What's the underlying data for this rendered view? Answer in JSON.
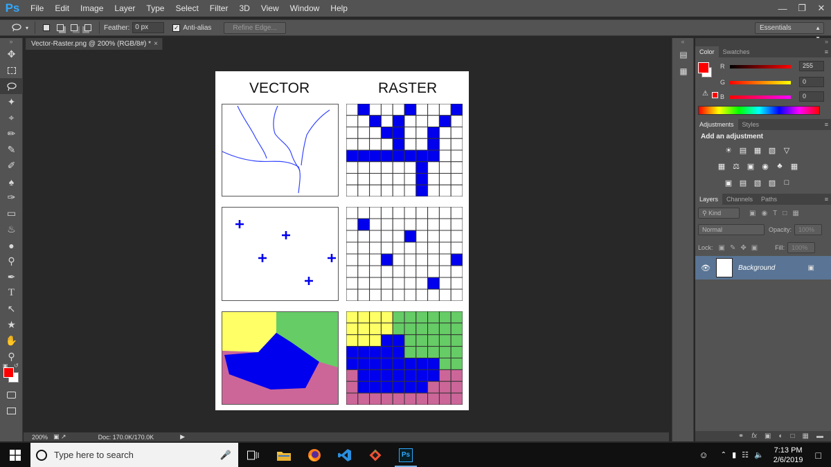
{
  "app": {
    "logo": "Ps",
    "menu": [
      "File",
      "Edit",
      "Image",
      "Layer",
      "Type",
      "Select",
      "Filter",
      "3D",
      "View",
      "Window",
      "Help"
    ]
  },
  "options_bar": {
    "feather_label": "Feather:",
    "feather_value": "0 px",
    "antialias_label": "Anti-alias",
    "antialias_checked": true,
    "refine_edge_label": "Refine Edge...",
    "workspace": "Essentials"
  },
  "document": {
    "tab_title": "Vector-Raster.png @ 200% (RGB/8#) *",
    "heading_vector": "VECTOR",
    "heading_raster": "RASTER"
  },
  "status_bar": {
    "zoom": "200%",
    "doc_size": "Doc: 170.0K/170.0K"
  },
  "color_panel": {
    "tabs": [
      "Color",
      "Swatches"
    ],
    "foreground": "#ff0000",
    "background": "#ffffff",
    "channels": [
      {
        "label": "R",
        "value": "255"
      },
      {
        "label": "G",
        "value": "0"
      },
      {
        "label": "B",
        "value": "0"
      }
    ]
  },
  "adjustments_panel": {
    "tabs": [
      "Adjustments",
      "Styles"
    ],
    "title": "Add an adjustment"
  },
  "layers_panel": {
    "tabs": [
      "Layers",
      "Channels",
      "Paths"
    ],
    "kind_filter": "Kind",
    "blend_mode": "Normal",
    "opacity_label": "Opacity:",
    "opacity_value": "100%",
    "lock_label": "Lock:",
    "fill_label": "Fill:",
    "fill_value": "100%",
    "layers": [
      {
        "name": "Background",
        "visible": true,
        "locked": true
      }
    ]
  },
  "taskbar": {
    "search_placeholder": "Type here to search",
    "time": "7:13 PM",
    "date": "2/6/2019"
  },
  "colors": {
    "blue": "#0000ee",
    "yellow": "#ffff66",
    "green": "#66cc66",
    "pink": "#cc6699"
  }
}
